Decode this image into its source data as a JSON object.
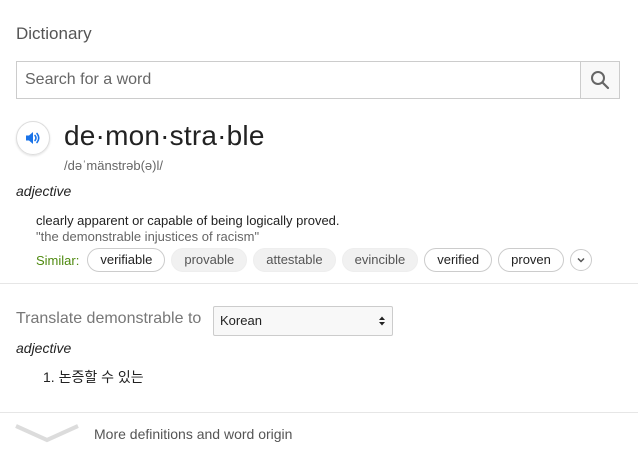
{
  "title": "Dictionary",
  "search": {
    "placeholder": "Search for a word",
    "value": ""
  },
  "entry": {
    "headword": "de·mon·stra·ble",
    "phonetic": "/dəˈmänstrəb(ə)l/",
    "part_of_speech": "adjective",
    "definition": "clearly apparent or capable of being logically proved.",
    "example": "\"the demonstrable injustices of racism\"",
    "similar_label": "Similar:",
    "similar": [
      {
        "word": "verifiable",
        "style": "outlined"
      },
      {
        "word": "provable",
        "style": "filled"
      },
      {
        "word": "attestable",
        "style": "filled"
      },
      {
        "word": "evincible",
        "style": "filled"
      },
      {
        "word": "verified",
        "style": "outlined"
      },
      {
        "word": "proven",
        "style": "outlined"
      }
    ]
  },
  "translate": {
    "label": "Translate demonstrable to",
    "language": "Korean",
    "part_of_speech": "adjective",
    "translations": [
      "1. 논증할 수 있는"
    ]
  },
  "more": {
    "label": "More definitions and word origin"
  },
  "colors": {
    "accent_blue": "#1a73e8",
    "similar_green": "#4f8a10"
  }
}
